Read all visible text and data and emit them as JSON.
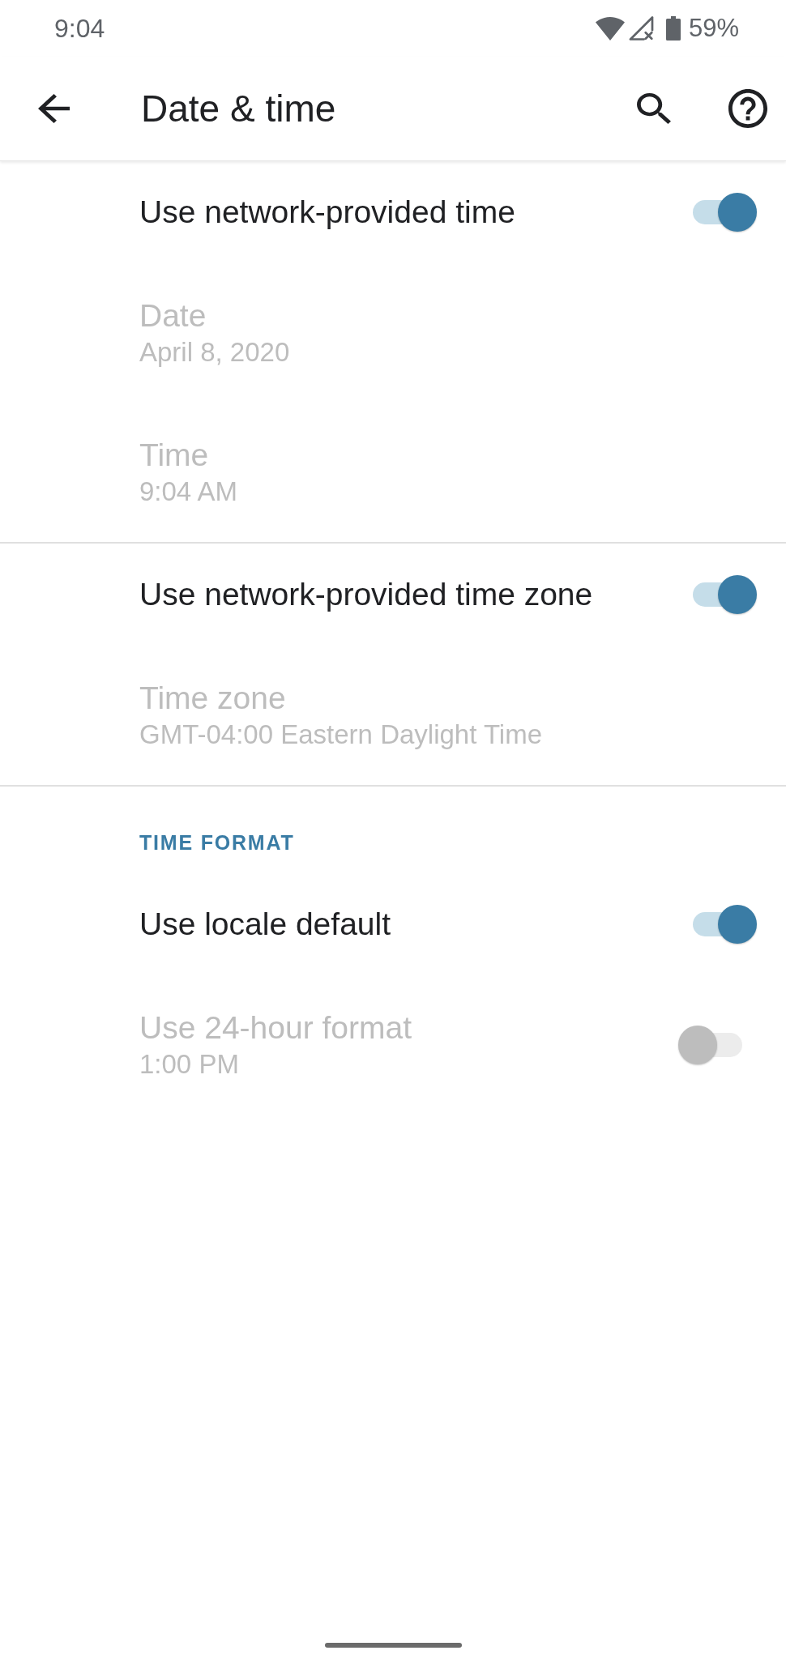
{
  "status_bar": {
    "time": "9:04",
    "battery": "59%"
  },
  "app_bar": {
    "title": "Date & time"
  },
  "sections": [
    {
      "items": [
        {
          "kind": "switch",
          "title": "Use network-provided time",
          "on": true,
          "disabled": false
        },
        {
          "kind": "text",
          "title": "Date",
          "summary": "April 8, 2020",
          "disabled": true
        },
        {
          "kind": "text",
          "title": "Time",
          "summary": "9:04 AM",
          "disabled": true
        }
      ]
    },
    {
      "items": [
        {
          "kind": "switch",
          "title": "Use network-provided time zone",
          "on": true,
          "disabled": false
        },
        {
          "kind": "text",
          "title": "Time zone",
          "summary": "GMT-04:00 Eastern Daylight Time",
          "disabled": true
        }
      ]
    },
    {
      "header": "TIME FORMAT",
      "items": [
        {
          "kind": "switch",
          "title": "Use locale default",
          "on": true,
          "disabled": false
        },
        {
          "kind": "switch",
          "title": "Use 24-hour format",
          "summary": "1:00 PM",
          "on": false,
          "disabled": true
        }
      ]
    }
  ]
}
